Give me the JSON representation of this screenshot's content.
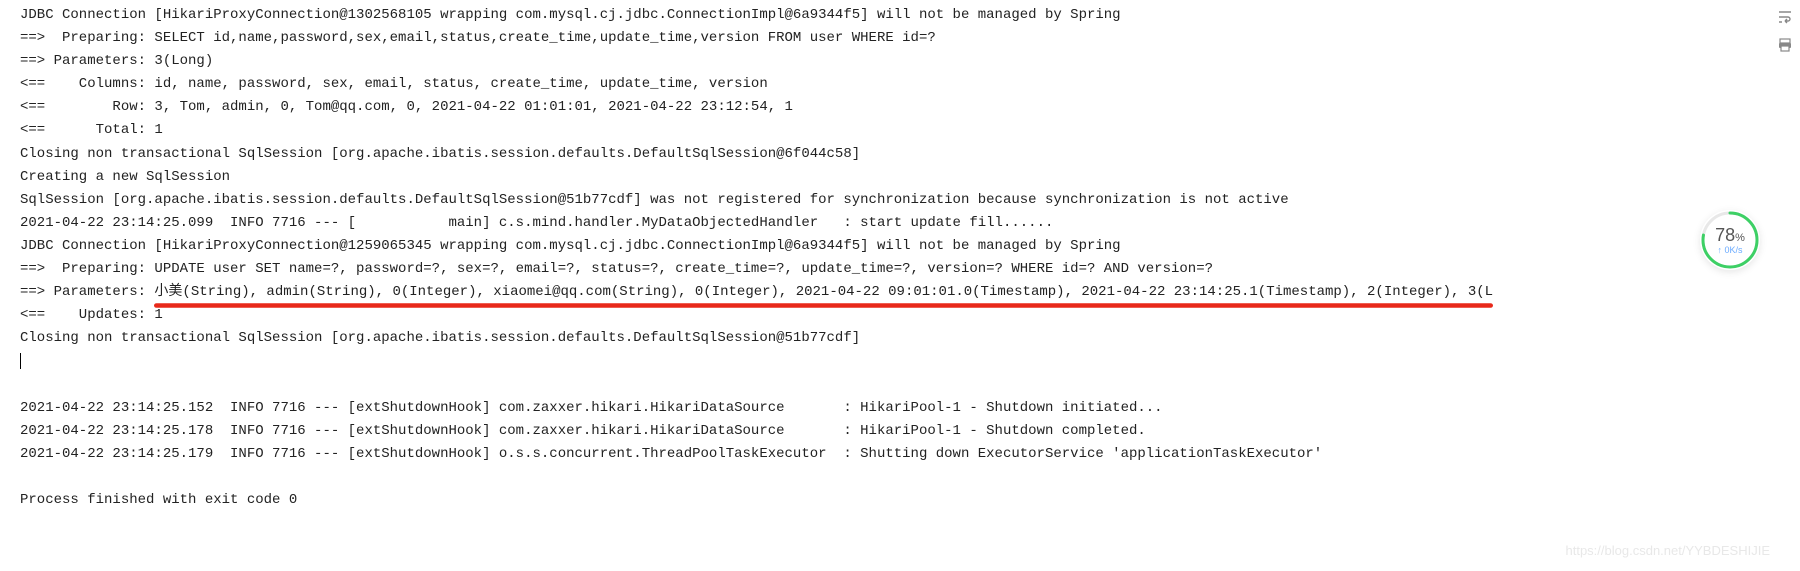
{
  "log_lines": [
    "JDBC Connection [HikariProxyConnection@1302568105 wrapping com.mysql.cj.jdbc.ConnectionImpl@6a9344f5] will not be managed by Spring",
    "==>  Preparing: SELECT id,name,password,sex,email,status,create_time,update_time,version FROM user WHERE id=?",
    "==> Parameters: 3(Long)",
    "<==    Columns: id, name, password, sex, email, status, create_time, update_time, version",
    "<==        Row: 3, Tom, admin, 0, Tom@qq.com, 0, 2021-04-22 01:01:01, 2021-04-22 23:12:54, 1",
    "<==      Total: 1",
    "Closing non transactional SqlSession [org.apache.ibatis.session.defaults.DefaultSqlSession@6f044c58]",
    "Creating a new SqlSession",
    "SqlSession [org.apache.ibatis.session.defaults.DefaultSqlSession@51b77cdf] was not registered for synchronization because synchronization is not active",
    "2021-04-22 23:14:25.099  INFO 7716 --- [           main] c.s.mind.handler.MyDataObjectedHandler   : start update fill......",
    "JDBC Connection [HikariProxyConnection@1259065345 wrapping com.mysql.cj.jdbc.ConnectionImpl@6a9344f5] will not be managed by Spring",
    "==>  Preparing: UPDATE user SET name=?, password=?, sex=?, email=?, status=?, create_time=?, update_time=?, version=? WHERE id=? AND version=?"
  ],
  "highlighted_prefix": "==> Parameters: ",
  "highlighted_params": "小美(String), admin(String), 0(Integer), xiaomei@qq.com(String), 0(Integer), 2021-04-22 09:01:01.0(Timestamp), 2021-04-22 23:14:25.1(Timestamp), 2(Integer), 3(L",
  "after_lines_1": [
    "<==    Updates: 1",
    "Closing non transactional SqlSession [org.apache.ibatis.session.defaults.DefaultSqlSession@51b77cdf]"
  ],
  "after_lines_2": [
    "",
    "2021-04-22 23:14:25.152  INFO 7716 --- [extShutdownHook] com.zaxxer.hikari.HikariDataSource       : HikariPool-1 - Shutdown initiated...",
    "2021-04-22 23:14:25.178  INFO 7716 --- [extShutdownHook] com.zaxxer.hikari.HikariDataSource       : HikariPool-1 - Shutdown completed.",
    "2021-04-22 23:14:25.179  INFO 7716 --- [extShutdownHook] o.s.s.concurrent.ThreadPoolTaskExecutor  : Shutting down ExecutorService 'applicationTaskExecutor'",
    "",
    "Process finished with exit code 0"
  ],
  "badge": {
    "percent": "78",
    "percent_sign": "%",
    "rate": "0K/s",
    "arrow": "↑"
  },
  "watermark": "https://blog.csdn.net/YYBDESHIJIE"
}
